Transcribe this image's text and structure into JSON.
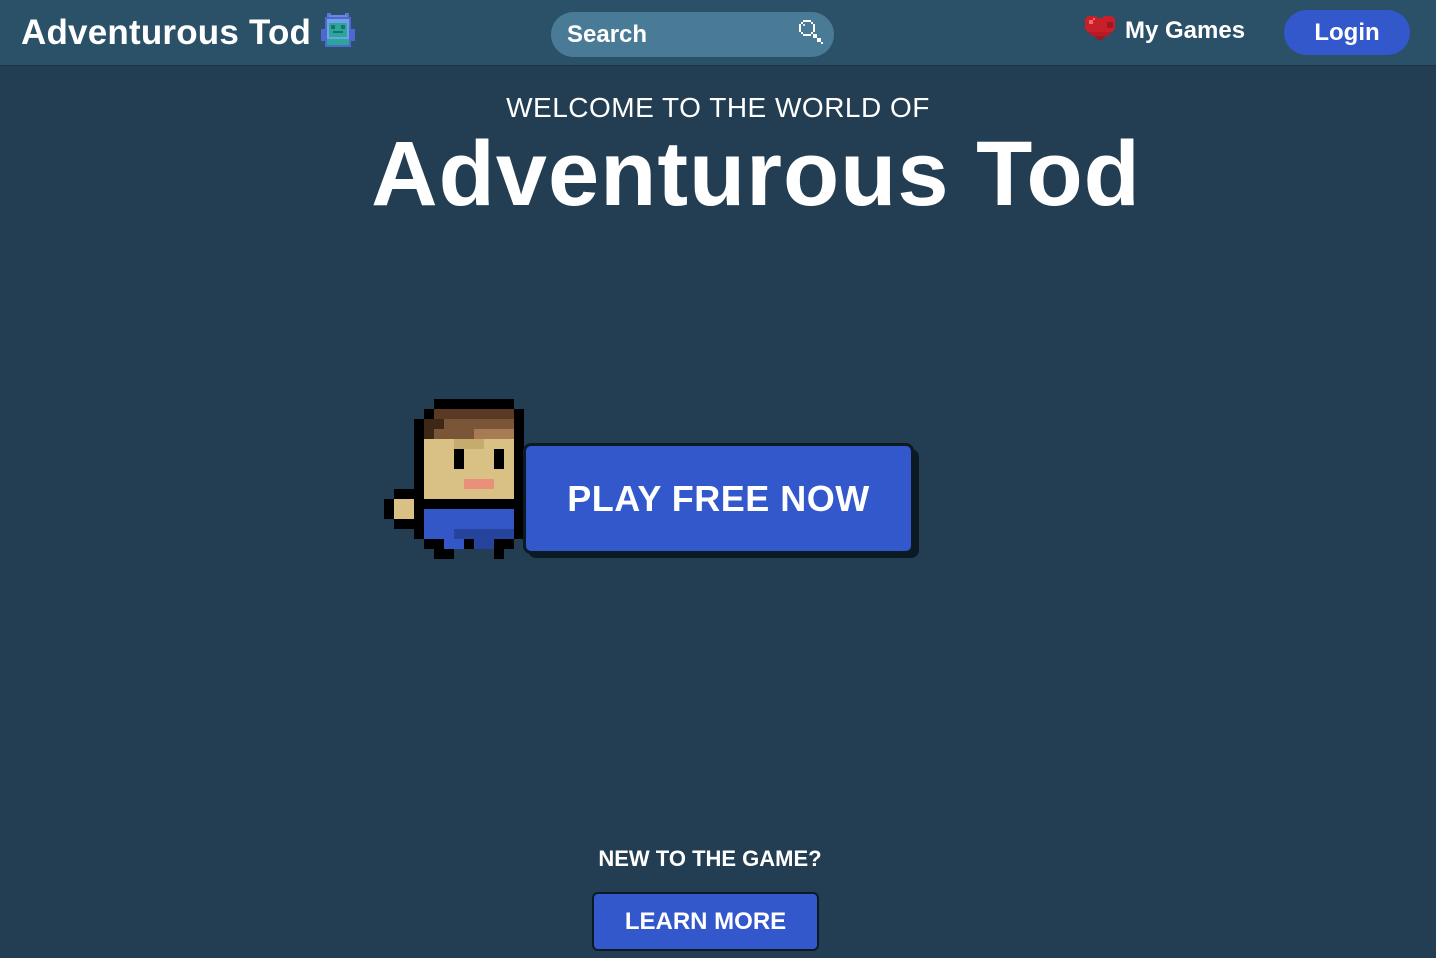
{
  "header": {
    "brand_name": "Adventurous Tod",
    "brand_icon": "backpack-icon",
    "search_placeholder": "Search",
    "search_icon": "magnifier-icon",
    "my_games_label": "My Games",
    "my_games_icon": "heart-icon",
    "login_label": "Login"
  },
  "hero": {
    "welcome_text": "WELCOME TO THE WORLD OF",
    "title": "Adventurous Tod",
    "character_icon": "pixel-character-icon",
    "play_label": "PLAY FREE NOW"
  },
  "footer_cta": {
    "question": "NEW TO THE GAME?",
    "learn_more_label": "LEARN MORE"
  },
  "colors": {
    "background": "#233e52",
    "topbar": "#2b5168",
    "search_field": "#4a7b96",
    "button_blue": "#3358cc",
    "outline_dark": "#0c1a24",
    "heart_red": "#c8202a",
    "text": "#ffffff"
  }
}
